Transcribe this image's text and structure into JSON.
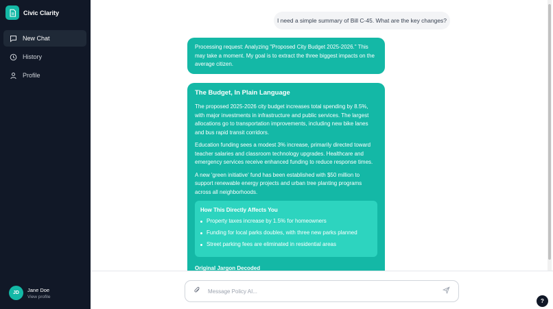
{
  "app": {
    "name": "Civic Clarity"
  },
  "sidebar": {
    "items": [
      {
        "label": "New Chat",
        "icon": "chat-bubble-icon",
        "active": true
      },
      {
        "label": "History",
        "icon": "clock-icon",
        "active": false
      },
      {
        "label": "Profile",
        "icon": "user-icon",
        "active": false
      }
    ]
  },
  "user": {
    "initials": "JD",
    "name": "Jane Doe",
    "sub": "View profile"
  },
  "chat": {
    "user_message": "I need a simple summary of Bill C-45. What are the key changes?",
    "bot_processing": "Processing request: Analyzing \"Proposed City Budget 2025-2026.\" This may take a moment. My goal is to extract the three biggest impacts on the average citizen.",
    "summary": {
      "title": "The Budget, In Plain Language",
      "paragraphs": [
        "The proposed 2025-2026 city budget increases total spending by 8.5%, with major investments in infrastructure and public services. The largest allocations go to transportation improvements, including new bike lanes and bus rapid transit corridors.",
        "Education funding sees a modest 3% increase, primarily directed toward teacher salaries and classroom technology upgrades. Healthcare and emergency services receive enhanced funding to reduce response times.",
        "A new 'green initiative' fund has been established with $50 million to support renewable energy projects and urban tree planting programs across all neighborhoods."
      ],
      "impact": {
        "title": "How This Directly Affects You",
        "items": [
          "Property taxes increase by 1.5% for homeowners",
          "Funding for local parks doubles, with three new parks planned",
          "Street parking fees are eliminated in residential areas"
        ]
      },
      "next_section_title": "Original Jargon Decoded"
    }
  },
  "composer": {
    "placeholder": "Message Policy AI..."
  },
  "help": {
    "label": "?"
  },
  "colors": {
    "accent": "#14b8a6",
    "sidebar_bg": "#111827",
    "impact_bg": "#2dd4bf"
  }
}
